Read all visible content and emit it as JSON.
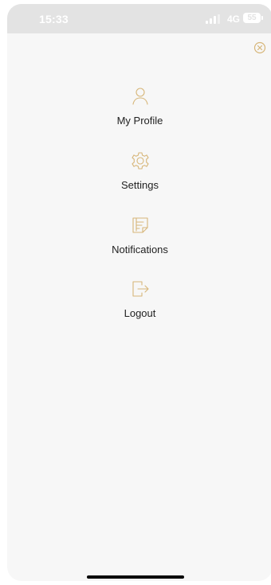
{
  "status_bar": {
    "time": "15:33",
    "network": "4G",
    "battery": "55"
  },
  "menu": {
    "items": [
      {
        "label": "My Profile",
        "icon": "user-icon"
      },
      {
        "label": "Settings",
        "icon": "gear-icon"
      },
      {
        "label": "Notifications",
        "icon": "notification-list-icon"
      },
      {
        "label": "Logout",
        "icon": "logout-icon"
      }
    ]
  },
  "colors": {
    "accent": "#d7b679",
    "background": "#f7f7f7",
    "status_bar": "#e3e3e3",
    "text": "#222222"
  }
}
